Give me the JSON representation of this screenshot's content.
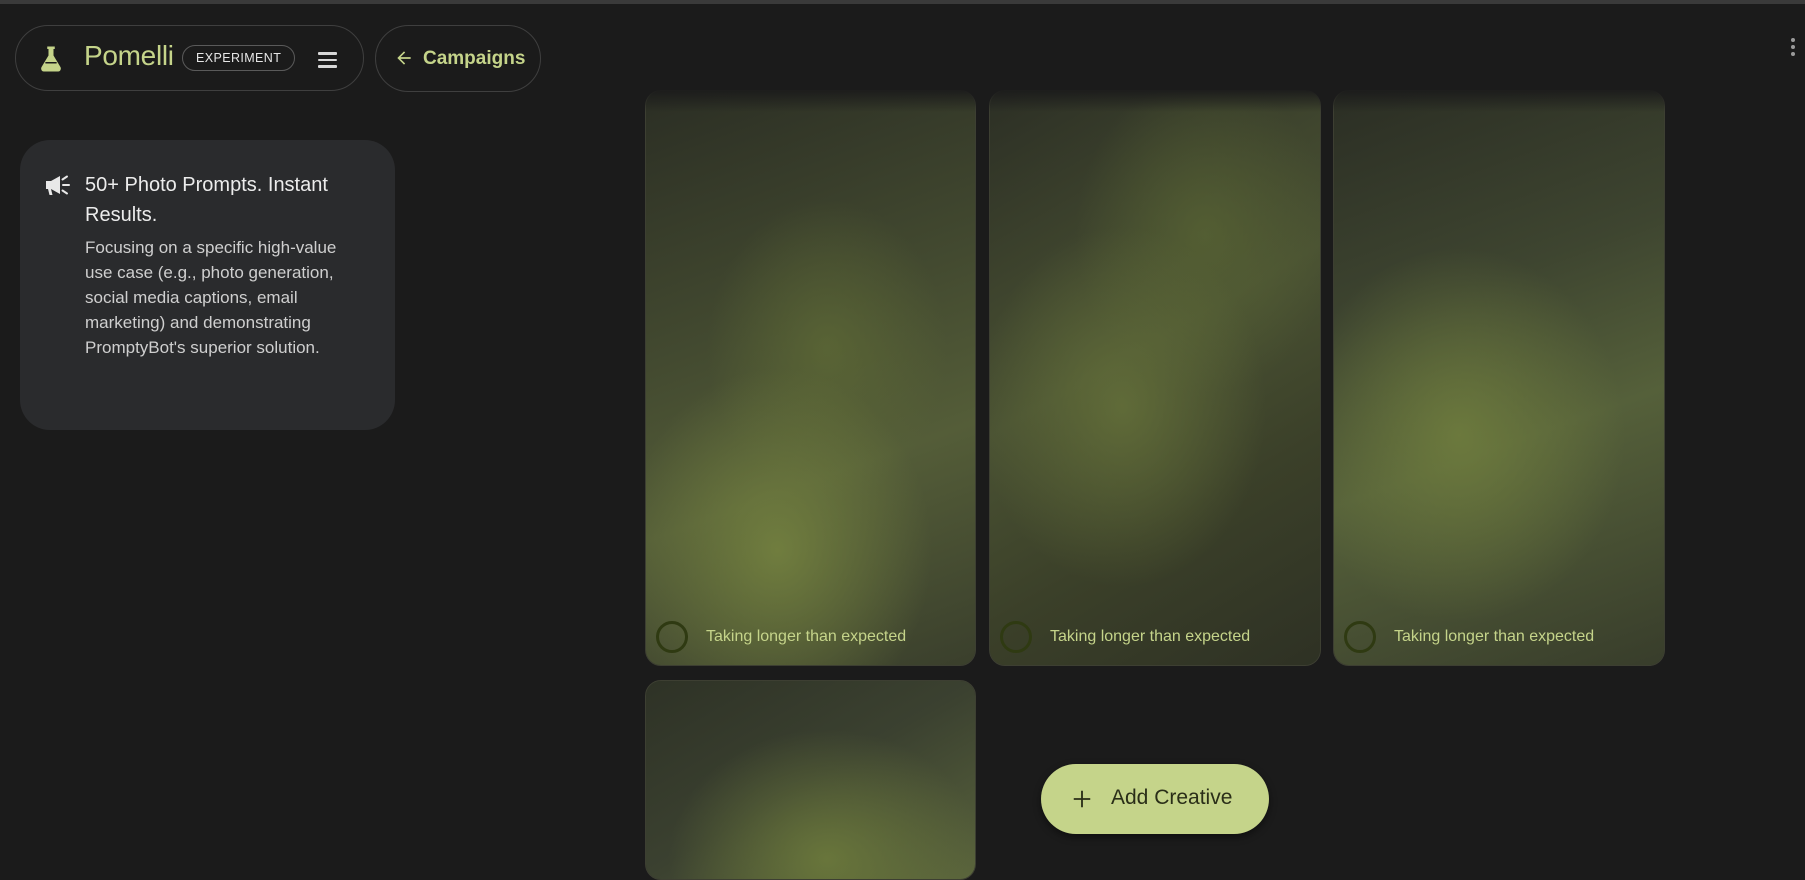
{
  "app": {
    "name": "Pomelli",
    "badge": "EXPERIMENT",
    "icons": {
      "logo": "flask-icon",
      "menu": "hamburger-menu-icon",
      "more": "more-vertical-icon"
    }
  },
  "nav": {
    "back_label": "Campaigns",
    "back_icon": "arrow-left-icon"
  },
  "info_card": {
    "icon": "megaphone-icon",
    "title": "50+ Photo Prompts. Instant Results.",
    "body": "Focusing on a specific high-value use case (e.g., photo generation, social media captions, email marketing) and demonstrating PromptyBot's superior solution."
  },
  "creatives": [
    {
      "status": "Taking longer than expected"
    },
    {
      "status": "Taking longer than expected"
    },
    {
      "status": "Taking longer than expected"
    },
    {
      "status": ""
    }
  ],
  "actions": {
    "add_creative_label": "Add Creative",
    "add_icon": "plus-icon"
  },
  "colors": {
    "accent": "#c5d48a",
    "background": "#1b1b1b",
    "card": "#2a2b2d"
  }
}
